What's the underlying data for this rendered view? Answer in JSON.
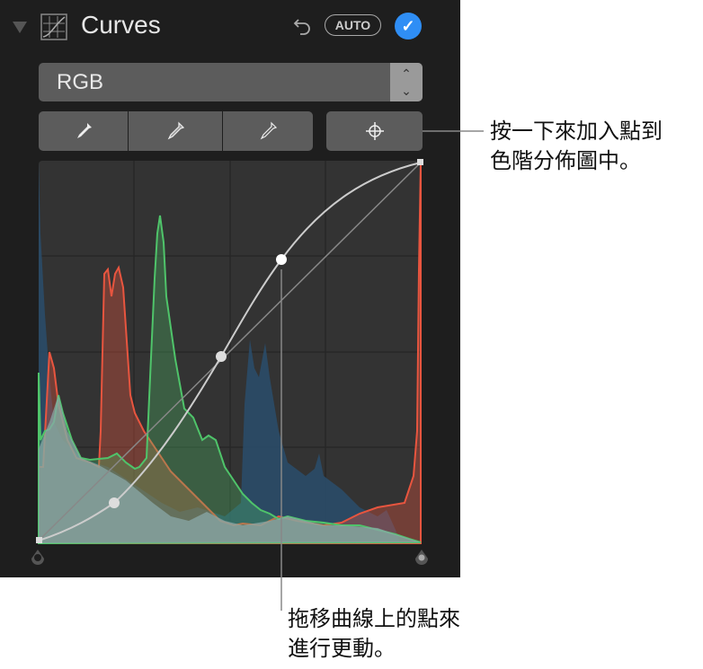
{
  "header": {
    "title": "Curves",
    "auto_label": "AUTO",
    "check": "✓"
  },
  "channel_select": {
    "value": "RGB"
  },
  "tools": {
    "eyedroppers": [
      "black-point-eyedropper",
      "gray-point-eyedropper",
      "white-point-eyedropper"
    ],
    "add_point": "crosshair-icon"
  },
  "colors": {
    "accent": "#2f8ef5",
    "red": "#e8553f",
    "green": "#4fc46a",
    "blue": "#2b4f6e"
  },
  "callouts": {
    "add_point": [
      "按一下來加入點到",
      "色階分佈圖中。"
    ],
    "drag_point": [
      "拖移曲線上的點來",
      "進行更動。"
    ]
  }
}
